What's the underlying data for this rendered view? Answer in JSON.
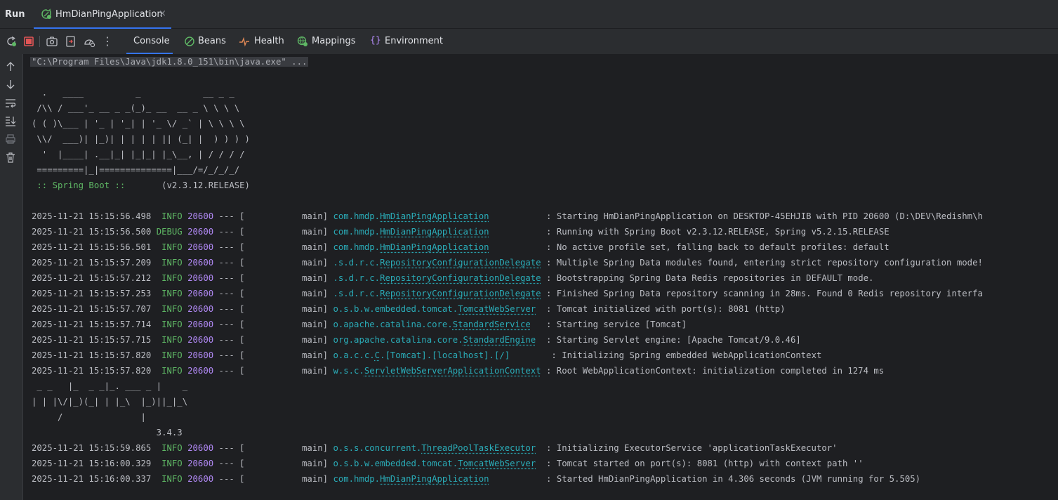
{
  "window": {
    "run_label": "Run",
    "tab_label": "HmDianPingApplication",
    "tab_close": "×"
  },
  "toolbar": {
    "tabs": [
      {
        "label": "Console",
        "icon": "console-icon"
      },
      {
        "label": "Beans",
        "icon": "beans-icon"
      },
      {
        "label": "Health",
        "icon": "health-icon"
      },
      {
        "label": "Mappings",
        "icon": "mappings-icon"
      },
      {
        "label": "Environment",
        "icon": "environment-icon"
      }
    ],
    "more": "⋮"
  },
  "colors": {
    "accent": "#3574f0",
    "info": "#5fb865",
    "pid": "#b189f5",
    "logger": "#2aacb8",
    "stop": "#e05555"
  },
  "console": {
    "command": "\"C:\\Program Files\\Java\\jdk1.8.0_151\\bin\\java.exe\" ...",
    "banner": [
      "  .   ____          _            __ _ _",
      " /\\\\ / ___'_ __ _ _(_)_ __  __ _ \\ \\ \\ \\",
      "( ( )\\___ | '_ | '_| | '_ \\/ _` | \\ \\ \\ \\",
      " \\\\/  ___)| |_)| | | | | || (_| |  ) ) ) )",
      "  '  |____| .__|_| |_|_| |_\\__, | / / / /",
      " =========|_|==============|___/=/_/_/_/"
    ],
    "spring_boot_label": " :: Spring Boot :: ",
    "spring_boot_version": "      (v2.3.12.RELEASE)",
    "logs_a": [
      {
        "ts": "2025-11-21 15:15:56.498",
        "level": " INFO",
        "pid": "20600",
        "thread": " --- [           main] ",
        "pkg": "com.hmdp.",
        "cls": "HmDianPingApplication",
        "pad": "          ",
        "msg": " : Starting HmDianPingApplication on DESKTOP-45EHJIB with PID 20600 (D:\\DEV\\Redishm\\h"
      },
      {
        "ts": "2025-11-21 15:15:56.500",
        "level": "DEBUG",
        "pid": "20600",
        "thread": " --- [           main] ",
        "pkg": "com.hmdp.",
        "cls": "HmDianPingApplication",
        "pad": "          ",
        "msg": " : Running with Spring Boot v2.3.12.RELEASE, Spring v5.2.15.RELEASE"
      },
      {
        "ts": "2025-11-21 15:15:56.501",
        "level": " INFO",
        "pid": "20600",
        "thread": " --- [           main] ",
        "pkg": "com.hmdp.",
        "cls": "HmDianPingApplication",
        "pad": "          ",
        "msg": " : No active profile set, falling back to default profiles: default"
      },
      {
        "ts": "2025-11-21 15:15:57.209",
        "level": " INFO",
        "pid": "20600",
        "thread": " --- [           main] ",
        "pkg": ".s.d.r.c.",
        "cls": "RepositoryConfigurationDelegate",
        "pad": "",
        "msg": " : Multiple Spring Data modules found, entering strict repository configuration mode!"
      },
      {
        "ts": "2025-11-21 15:15:57.212",
        "level": " INFO",
        "pid": "20600",
        "thread": " --- [           main] ",
        "pkg": ".s.d.r.c.",
        "cls": "RepositoryConfigurationDelegate",
        "pad": "",
        "msg": " : Bootstrapping Spring Data Redis repositories in DEFAULT mode."
      },
      {
        "ts": "2025-11-21 15:15:57.253",
        "level": " INFO",
        "pid": "20600",
        "thread": " --- [           main] ",
        "pkg": ".s.d.r.c.",
        "cls": "RepositoryConfigurationDelegate",
        "pad": "",
        "msg": " : Finished Spring Data repository scanning in 28ms. Found 0 Redis repository interfa"
      },
      {
        "ts": "2025-11-21 15:15:57.707",
        "level": " INFO",
        "pid": "20600",
        "thread": " --- [           main] ",
        "pkg": "o.s.b.w.embedded.tomcat.",
        "cls": "TomcatWebServer",
        "pad": " ",
        "msg": " : Tomcat initialized with port(s): 8081 (http)"
      },
      {
        "ts": "2025-11-21 15:15:57.714",
        "level": " INFO",
        "pid": "20600",
        "thread": " --- [           main] ",
        "pkg": "o.apache.catalina.core.",
        "cls": "StandardService",
        "pad": "  ",
        "msg": " : Starting service [Tomcat]"
      },
      {
        "ts": "2025-11-21 15:15:57.715",
        "level": " INFO",
        "pid": "20600",
        "thread": " --- [           main] ",
        "pkg": "org.apache.catalina.core.",
        "cls": "StandardEngine",
        "pad": " ",
        "msg": " : Starting Servlet engine: [Apache Tomcat/9.0.46]"
      },
      {
        "ts": "2025-11-21 15:15:57.820",
        "level": " INFO",
        "pid": "20600",
        "thread": " --- [           main] ",
        "pkg": "o.a.c.c.",
        "cls": "C",
        "pad": "",
        "rest": ".[Tomcat].[localhost].[/]       ",
        "msg": " : Initializing Spring embedded WebApplicationContext"
      },
      {
        "ts": "2025-11-21 15:15:57.820",
        "level": " INFO",
        "pid": "20600",
        "thread": " --- [           main] ",
        "pkg": "w.s.c.",
        "cls": "ServletWebServerApplicationContext",
        "pad": "",
        "msg": " : Root WebApplicationContext: initialization completed in 1274 ms"
      }
    ],
    "mybatis_banner": [
      " _ _   |_  _ _|_. ___ _ |    _",
      "| | |\\/|_)(_| | |_\\  |_)||_|_\\",
      "     /               |",
      "                        3.4.3"
    ],
    "logs_b": [
      {
        "ts": "2025-11-21 15:15:59.865",
        "level": " INFO",
        "pid": "20600",
        "thread": " --- [           main] ",
        "pkg": "o.s.s.concurrent.",
        "cls": "ThreadPoolTaskExecutor",
        "pad": " ",
        "msg": " : Initializing ExecutorService 'applicationTaskExecutor'"
      },
      {
        "ts": "2025-11-21 15:16:00.329",
        "level": " INFO",
        "pid": "20600",
        "thread": " --- [           main] ",
        "pkg": "o.s.b.w.embedded.tomcat.",
        "cls": "TomcatWebServer",
        "pad": " ",
        "msg": " : Tomcat started on port(s): 8081 (http) with context path ''"
      },
      {
        "ts": "2025-11-21 15:16:00.337",
        "level": " INFO",
        "pid": "20600",
        "thread": " --- [           main] ",
        "pkg": "com.hmdp.",
        "cls": "HmDianPingApplication",
        "pad": "          ",
        "msg": " : Started HmDianPingApplication in 4.306 seconds (JVM running for 5.505)"
      }
    ]
  }
}
